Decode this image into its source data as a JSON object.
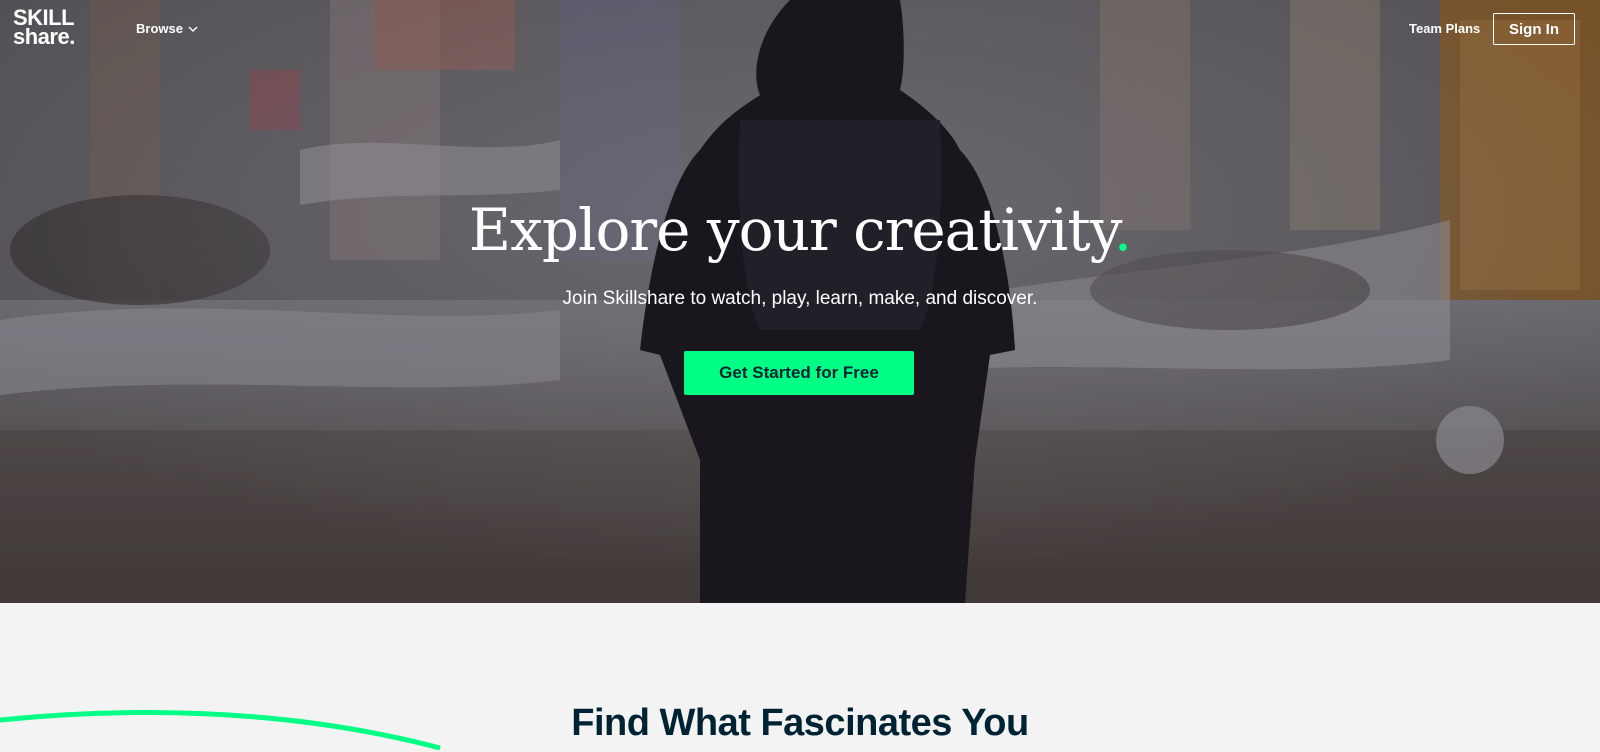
{
  "nav": {
    "logo_line1": "SKILL",
    "logo_line2": "share.",
    "browse_label": "Browse",
    "team_plans_label": "Team Plans",
    "sign_in_label": "Sign In"
  },
  "hero": {
    "headline": "Explore your creativity",
    "headline_period": ".",
    "subheadline": "Join Skillshare to watch, play, learn, make, and discover.",
    "cta_label": "Get Started for Free"
  },
  "section": {
    "title": "Find What Fascinates You"
  },
  "colors": {
    "accent": "#00ff84",
    "dark": "#002333",
    "section_bg": "#f3f3f3"
  },
  "icons": [
    "chevron-down-icon"
  ]
}
